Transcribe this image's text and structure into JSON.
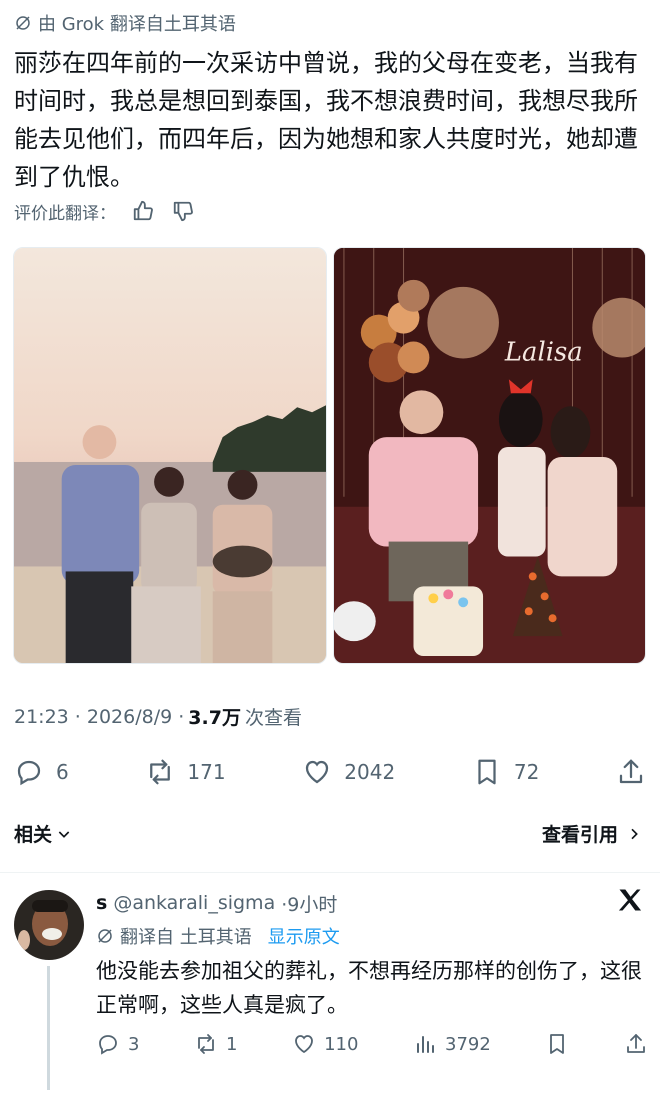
{
  "grok_translation": "由 Grok 翻译自土耳其语",
  "tweet_text": "丽莎在四年前的一次采访中曾说，我的父母在变老，当我有时间时，我总是想回到泰国，我不想浪费时间，我想尽我所能去见他们，而四年后，因为她想和家人共度时光，她却遭到了仇恨。",
  "rate_translation": "评价此翻译：",
  "meta": {
    "time": "21:23 · 2026/8/9 · ",
    "views": "3.7万",
    "views_label": "次查看"
  },
  "actions": {
    "replies": "6",
    "reposts": "171",
    "likes": "2042",
    "bookmarks": "72"
  },
  "related": "相关",
  "view_quotes": "查看引用",
  "photo2_sign_text": "Lalisa",
  "reply": {
    "name": "s",
    "handle": "@ankarali_sigma",
    "time": "·9小时",
    "translated_from": "翻译自 土耳其语",
    "show_original": "显示原文",
    "text": "他没能去参加祖父的葬礼，不想再经历那样的创伤了，这很正常啊，这些人真是疯了。",
    "replies": "3",
    "reposts": "1",
    "likes": "110",
    "views": "3792"
  },
  "colors": {
    "text": "#0f1419",
    "muted": "#536471",
    "link": "#1d9bf0"
  }
}
